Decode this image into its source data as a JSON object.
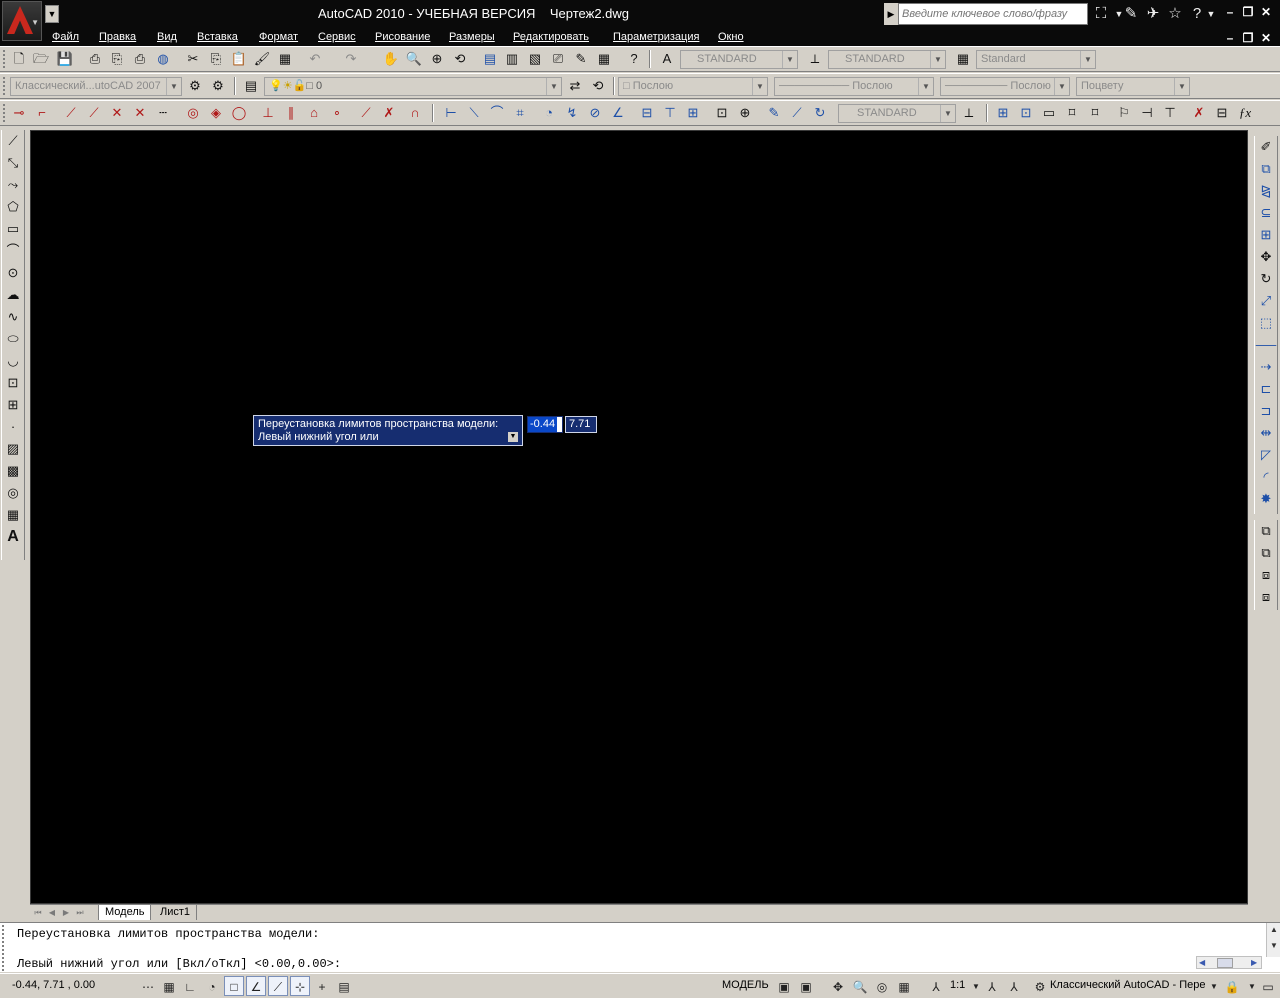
{
  "title": {
    "text": "AutoCAD 2010 - УЧЕБНАЯ ВЕРСИЯ    Чертеж2.dwg",
    "search_placeholder": "Введите ключевое слово/фразу"
  },
  "menu": [
    "Файл",
    "Правка",
    "Вид",
    "Вставка",
    "Формат",
    "Сервис",
    "Рисование",
    "Размеры",
    "Редактировать",
    "Параметризация",
    "Окно"
  ],
  "toolbar1": {
    "text_style": "STANDARD",
    "dim_style": "STANDARD",
    "table_style": "Standard"
  },
  "toolbar2": {
    "workspace": "Классический...utoCAD 2007",
    "layer": "0",
    "color": "Послою",
    "linetype": "Послою",
    "lineweight": "Послою",
    "plotstyle": "Поцвету"
  },
  "toolbar3": {
    "dim_style": "STANDARD"
  },
  "prompt": {
    "line1": "Переустановка лимитов пространства модели:",
    "line2": "Левый нижний угол или",
    "x": "-0.44",
    "y": "7.71"
  },
  "tabs": {
    "model": "Модель",
    "sheet": "Лист1"
  },
  "command": {
    "line1": "Переустановка лимитов пространства модели:",
    "line2": "Левый нижний угол или [Вкл/оТкл] <0.00,0.00>:"
  },
  "status": {
    "coords": "-0.44, 7.71 , 0.00",
    "model_label": "МОДЕЛЬ",
    "scale": "1:1",
    "workspace": "Классический AutoCAD - Пере"
  }
}
